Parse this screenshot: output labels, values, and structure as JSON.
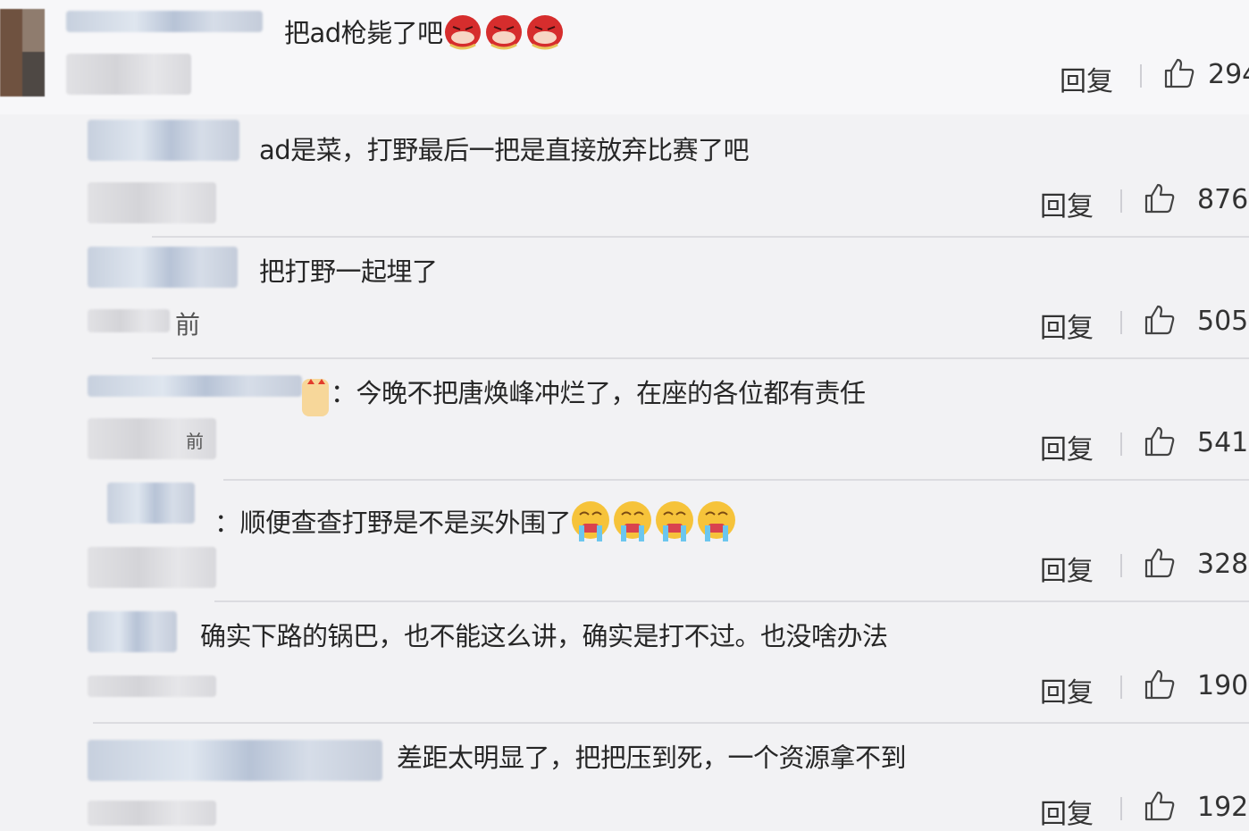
{
  "top_comment": {
    "text": "把ad枪毙了吧",
    "emoji_count": 3,
    "reply_label": "回复",
    "likes": "294"
  },
  "replies": [
    {
      "text": "ad是菜，打野最后一把是直接放弃比赛了吧",
      "reply_label": "回复",
      "likes": "876"
    },
    {
      "text": "把打野一起埋了",
      "meta": "前",
      "reply_label": "回复",
      "likes": "505"
    },
    {
      "prefix": "：",
      "text": "今晚不把唐焕峰冲烂了，在座的各位都有责任",
      "meta": "前",
      "reply_label": "回复",
      "likes": "541"
    },
    {
      "prefix": "：",
      "text": "顺便查查打野是不是买外围了",
      "emoji_count": 4,
      "reply_label": "回复",
      "likes": "328"
    },
    {
      "text": "确实下路的锅巴，也不能这么讲，确实是打不过。也没啥办法",
      "reply_label": "回复",
      "likes": "190"
    },
    {
      "text": "差距太明显了，把把压到死，一个资源拿不到",
      "reply_label": "回复",
      "likes": "192"
    }
  ],
  "icons": {
    "like": "thumbs-up-icon",
    "emoji_red": "red-angry-face-icon",
    "emoji_cry": "crying-face-icon"
  },
  "colors": {
    "background": "#f2f2f4",
    "text": "#262626",
    "divider": "#dcdce0"
  }
}
